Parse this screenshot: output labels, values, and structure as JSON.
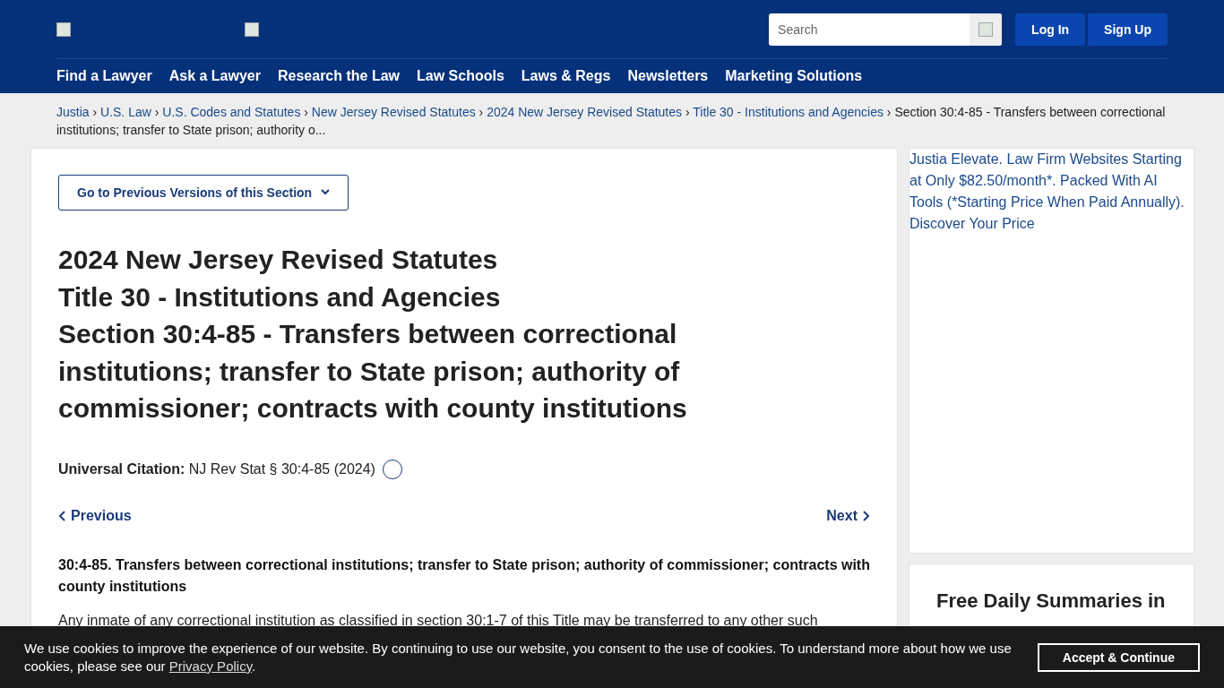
{
  "header": {
    "search": {
      "placeholder": "Search"
    },
    "buttons": [
      "Log In",
      "Sign Up"
    ],
    "nav": [
      "Find a Lawyer",
      "Ask a Lawyer",
      "Research the Law",
      "Law Schools",
      "Laws & Regs",
      "Newsletters",
      "Marketing Solutions"
    ]
  },
  "breadcrumbs": {
    "links": [
      "Justia",
      "U.S. Law",
      "U.S. Codes and Statutes",
      "New Jersey Revised Statutes",
      "2024 New Jersey Revised Statutes",
      "Title 30 - Institutions and Agencies"
    ],
    "separator": "›",
    "current": [
      "Section 30:4-85 - Transfers between correctional",
      "institutions; transfer to State prison; authority o..."
    ]
  },
  "main": {
    "versions_button": "Go to Previous Versions of this Section",
    "title_lines": [
      "2024 New Jersey Revised Statutes",
      "Title 30 - Institutions and Agencies",
      "Section 30:4-85 - Transfers between correctional institutions; transfer to State prison; authority of commissioner; contracts with county institutions"
    ],
    "citation_label": "Universal Citation:",
    "citation": "NJ Rev Stat § 30:4-85 (2024)",
    "previous": "Previous",
    "next": "Next",
    "section_heading": "30:4-85. Transfers between correctional institutions; transfer to State prison; authority of commissioner; contracts with county institutions",
    "paragraph": "Any inmate of any correctional institution as classified in section 30:1-7 of this Title may be transferred to any other such"
  },
  "sidebar": {
    "ad_alt": "Justia Elevate. Law Firm Websites Starting at Only $82.50/month*. Packed With AI Tools (*Starting Price When Paid Annually). Discover Your Price",
    "newsletter_title": "Free Daily Summaries in"
  },
  "cookie": {
    "text": "We use cookies to improve the experience of our website. By continuing to use our website, you consent to the use of cookies. To understand more about how we use cookies, please see our",
    "link": "Privacy Policy",
    "after": ".",
    "button": "Accept & Continue"
  }
}
